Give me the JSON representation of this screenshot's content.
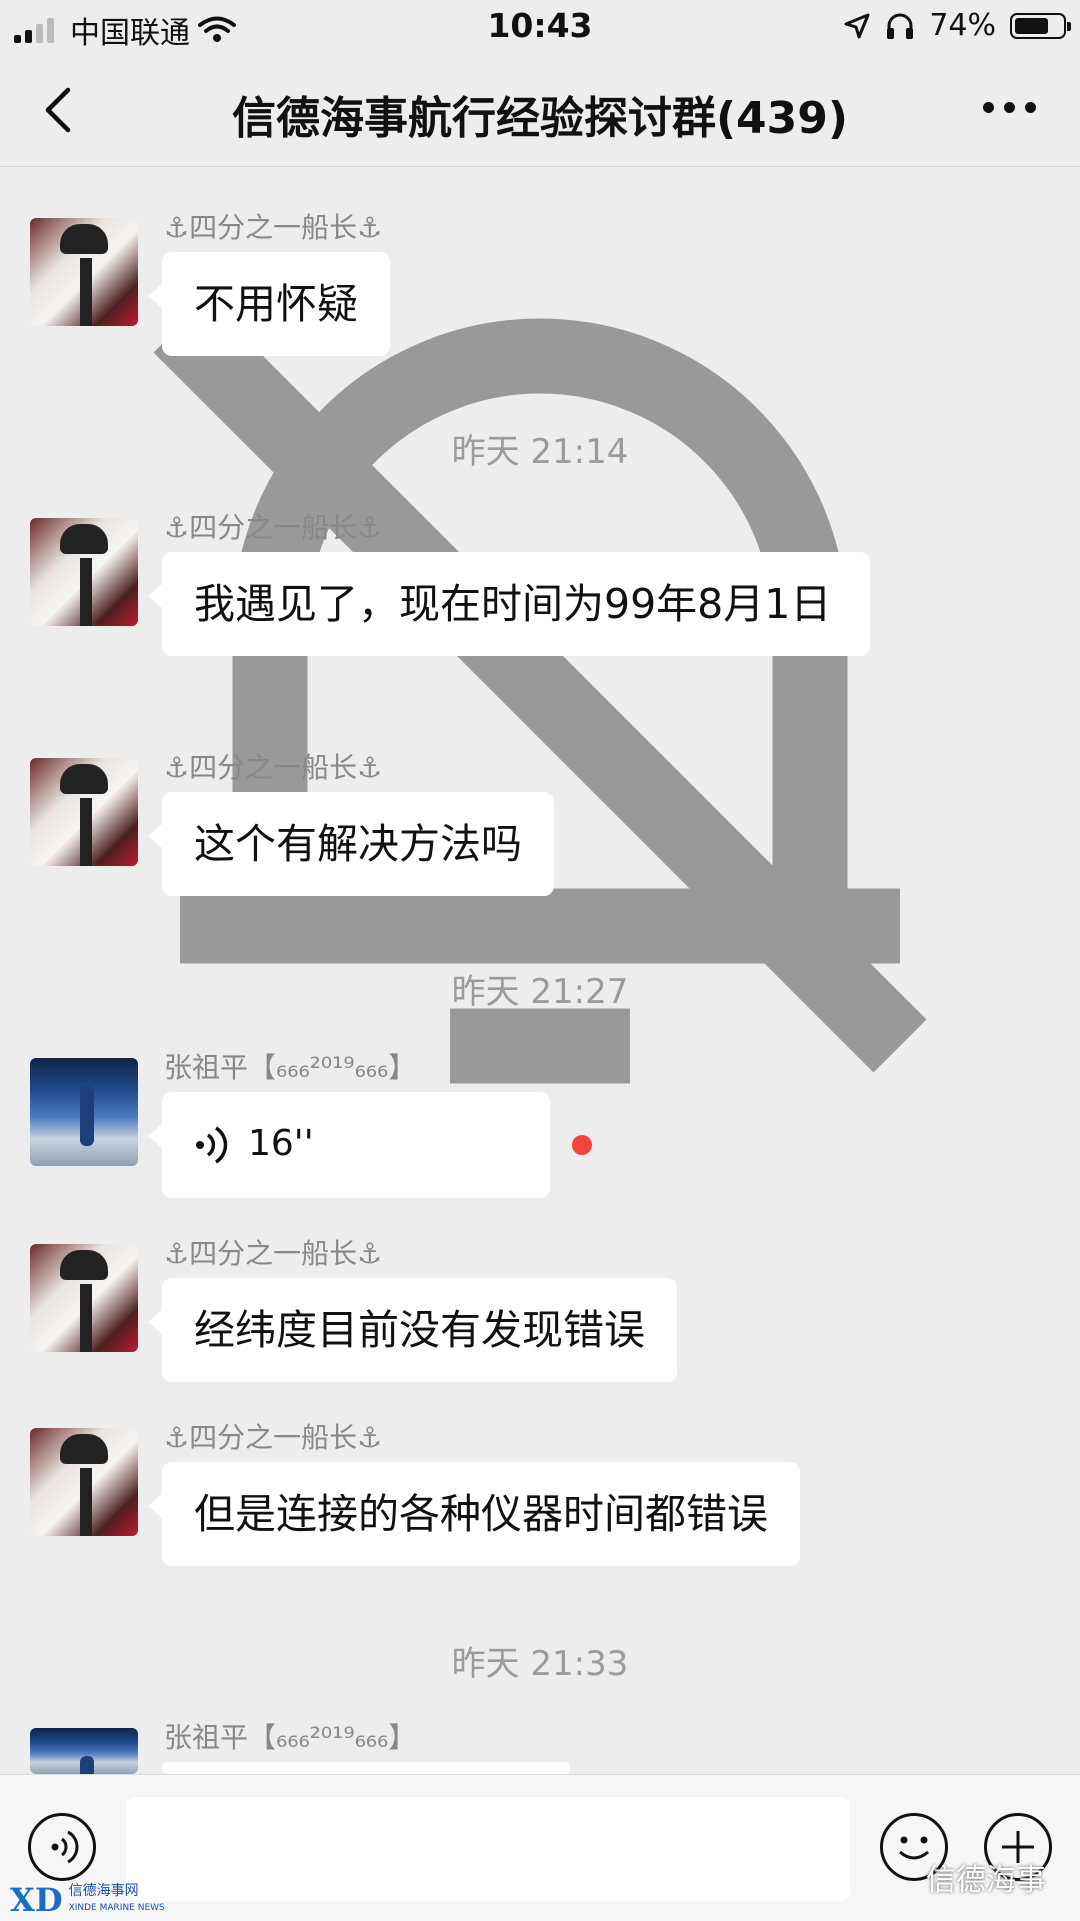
{
  "status_bar": {
    "carrier": "中国联通",
    "time": "10:43",
    "battery": "74%",
    "battery_level": 0.74
  },
  "nav": {
    "title": "信德海事航行经验探讨群(439)"
  },
  "messages": [
    {
      "sender": "⚓四分之一船长⚓",
      "text": "不用怀疑"
    },
    {
      "timestamp": "昨天 21:14"
    },
    {
      "sender": "⚓四分之一船长⚓",
      "text": "我遇见了，现在时间为99年8月1日"
    },
    {
      "sender": "⚓四分之一船长⚓",
      "text": "这个有解决方法吗"
    },
    {
      "timestamp": "昨天 21:27"
    },
    {
      "sender": "张祖平【₆₆₆²⁰¹⁹₆₆₆】",
      "voice_duration": "16''"
    },
    {
      "sender": "⚓四分之一船长⚓",
      "text": "经纬度目前没有发现错误"
    },
    {
      "sender": "⚓四分之一船长⚓",
      "text": "但是连接的各种仪器时间都错误"
    },
    {
      "timestamp": "昨天 21:33"
    },
    {
      "sender": "张祖平【₆₆₆²⁰¹⁹₆₆₆】"
    }
  ],
  "watermark": {
    "text": "信德海事",
    "logo_main": "XD",
    "logo_cn": "信德海事网",
    "logo_en": "XINDE MARINE NEWS"
  },
  "colors": {
    "background": "#ededed",
    "bubble": "#ffffff",
    "unread": "#f0453a"
  }
}
